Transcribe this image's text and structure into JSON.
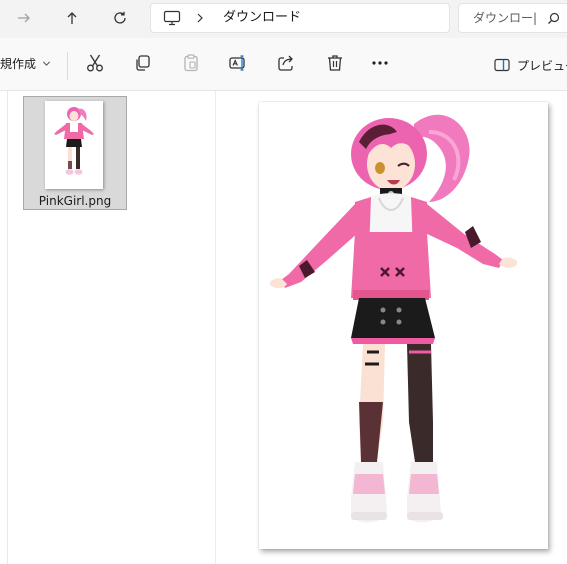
{
  "address_bar": {
    "breadcrumb": {
      "current_folder": "ダウンロード",
      "root_icon": "pc-icon",
      "separator_icon": "chevron-right-icon"
    },
    "search": {
      "text": "ダウンロー|",
      "icon": "search-icon"
    },
    "nav": {
      "forward_icon": "arrow-right-icon",
      "up_icon": "arrow-up-icon",
      "refresh_icon": "refresh-icon"
    }
  },
  "command_bar": {
    "new_label": "新規作成",
    "new_icon": "chevron-down-icon",
    "actions": [
      "cut-icon",
      "copy-icon",
      "paste-icon",
      "rename-icon",
      "share-icon",
      "delete-icon",
      "more-icon"
    ],
    "more_label": "•••",
    "preview_label": "プレビュー",
    "preview_icon": "preview-pane-icon"
  },
  "files": [
    {
      "name": "PinkGirl.png",
      "selected": true
    }
  ],
  "preview": {
    "image": "pink-girl-character-illustration"
  },
  "colors": {
    "accent_pink": "#ef5aa2",
    "hair_pink": "#f179be",
    "jacket_pink": "#f06aa8",
    "skirt_black": "#1b1b1b",
    "stocking_dark": "#3a2a2a",
    "selection_bg": "#d9d9d9"
  }
}
